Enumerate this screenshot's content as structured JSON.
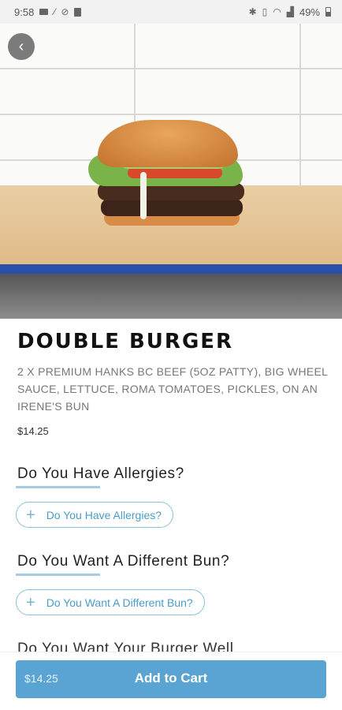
{
  "status_bar": {
    "time": "9:58",
    "battery_percent": "49%"
  },
  "product": {
    "title": "DOUBLE BURGER",
    "description": "2 X PREMIUM HANKS BC BEEF (5oz PATTY), BIG WHEEL SAUCE, LETTUCE, ROMA TOMATOES, PICKLES, ON AN IRENE'S BUN",
    "price": "$14.25"
  },
  "options": [
    {
      "title": "Do You Have Allergies?",
      "button_label": "Do You Have Allergies?"
    },
    {
      "title": "Do You Want A Different Bun?",
      "button_label": "Do You Want A Different Bun?"
    },
    {
      "title": "Do You Want Your Burger Well"
    }
  ],
  "cart": {
    "price": "$14.25",
    "label": "Add to Cart"
  },
  "icons": {
    "back": "back-arrow-icon",
    "add": "plus-icon"
  },
  "colors": {
    "accent": "#5aa4d3",
    "option_border": "#8cc1dc",
    "option_text": "#4a9cc8"
  }
}
